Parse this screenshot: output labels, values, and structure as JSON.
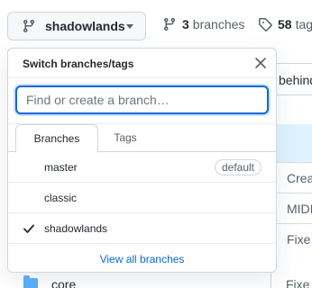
{
  "branch_selector": {
    "current_branch": "shadowlands",
    "icon": "git-branch-icon",
    "caret_icon": "triangle-down-icon"
  },
  "repo_meta": {
    "branches_count": "3",
    "branches_label": "branches",
    "tags_count": "58",
    "tags_label": "tags"
  },
  "background": {
    "behind_text": "behind",
    "row_texts": [
      "Crea",
      "MIDI",
      "Fixe"
    ],
    "core_folder": "core",
    "core_right": "Fixe"
  },
  "dropdown": {
    "title": "Switch branches/tags",
    "filter_placeholder": "Find or create a branch…",
    "filter_value": "",
    "tabs": [
      {
        "label": "Branches",
        "active": true
      },
      {
        "label": "Tags",
        "active": false
      }
    ],
    "branches": [
      {
        "name": "master",
        "badge": "default",
        "selected": false
      },
      {
        "name": "classic",
        "badge": "",
        "selected": false
      },
      {
        "name": "shadowlands",
        "badge": "",
        "selected": true
      }
    ],
    "view_all_label": "View all branches"
  },
  "colors": {
    "accent": "#0969da",
    "border": "#d0d7de",
    "muted_text": "#57606a",
    "folder": "#54aeff",
    "highlight_row": "#ddf4ff"
  }
}
